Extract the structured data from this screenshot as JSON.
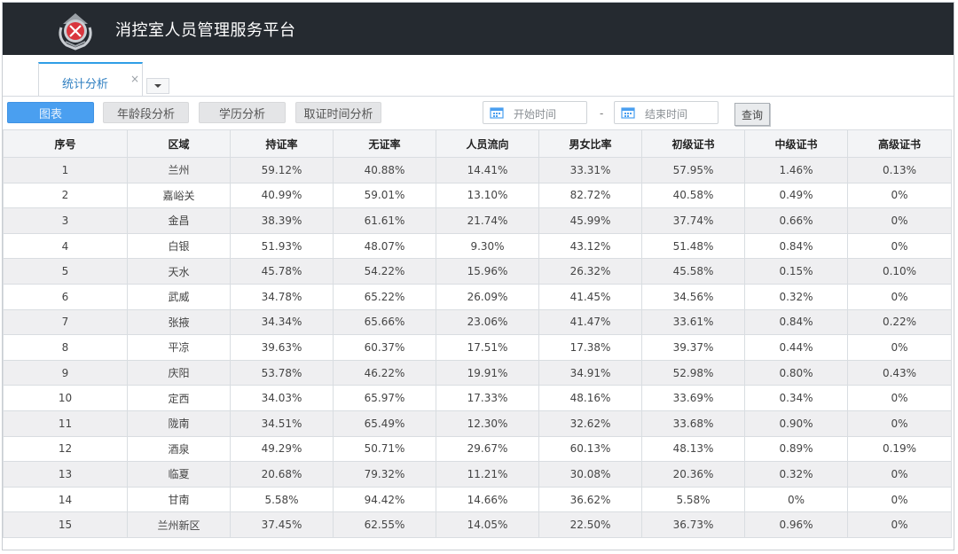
{
  "app": {
    "title": "消控室人员管理服务平台"
  },
  "tabs": [
    {
      "label": "统计分析",
      "close": "×"
    }
  ],
  "toolbar": {
    "buttons": [
      "图表",
      "年龄段分析",
      "学历分析",
      "取证时间分析"
    ],
    "start_placeholder": "开始时间",
    "separator": "-",
    "end_placeholder": "结束时间",
    "query_label": "查询"
  },
  "colors": {
    "header_bg": "#252a30",
    "primary": "#4a9ff0",
    "tab_accent": "#2f9ee6"
  },
  "table": {
    "headers": [
      "序号",
      "区域",
      "持证率",
      "无证率",
      "人员流向",
      "男女比率",
      "初级证书",
      "中级证书",
      "高级证书"
    ],
    "rows": [
      [
        "1",
        "兰州",
        "59.12%",
        "40.88%",
        "14.41%",
        "33.31%",
        "57.95%",
        "1.46%",
        "0.13%"
      ],
      [
        "2",
        "嘉峪关",
        "40.99%",
        "59.01%",
        "13.10%",
        "82.72%",
        "40.58%",
        "0.49%",
        "0%"
      ],
      [
        "3",
        "金昌",
        "38.39%",
        "61.61%",
        "21.74%",
        "45.99%",
        "37.74%",
        "0.66%",
        "0%"
      ],
      [
        "4",
        "白银",
        "51.93%",
        "48.07%",
        "9.30%",
        "43.12%",
        "51.48%",
        "0.84%",
        "0%"
      ],
      [
        "5",
        "天水",
        "45.78%",
        "54.22%",
        "15.96%",
        "26.32%",
        "45.58%",
        "0.15%",
        "0.10%"
      ],
      [
        "6",
        "武威",
        "34.78%",
        "65.22%",
        "26.09%",
        "41.45%",
        "34.56%",
        "0.32%",
        "0%"
      ],
      [
        "7",
        "张掖",
        "34.34%",
        "65.66%",
        "23.06%",
        "41.47%",
        "33.61%",
        "0.84%",
        "0.22%"
      ],
      [
        "8",
        "平凉",
        "39.63%",
        "60.37%",
        "17.51%",
        "17.38%",
        "39.37%",
        "0.44%",
        "0%"
      ],
      [
        "9",
        "庆阳",
        "53.78%",
        "46.22%",
        "19.91%",
        "34.91%",
        "52.98%",
        "0.80%",
        "0.43%"
      ],
      [
        "10",
        "定西",
        "34.03%",
        "65.97%",
        "17.33%",
        "48.16%",
        "33.69%",
        "0.34%",
        "0%"
      ],
      [
        "11",
        "陇南",
        "34.51%",
        "65.49%",
        "12.30%",
        "32.62%",
        "33.68%",
        "0.90%",
        "0%"
      ],
      [
        "12",
        "酒泉",
        "49.29%",
        "50.71%",
        "29.67%",
        "60.13%",
        "48.13%",
        "0.89%",
        "0.19%"
      ],
      [
        "13",
        "临夏",
        "20.68%",
        "79.32%",
        "11.21%",
        "30.08%",
        "20.36%",
        "0.32%",
        "0%"
      ],
      [
        "14",
        "甘南",
        "5.58%",
        "94.42%",
        "14.66%",
        "36.62%",
        "5.58%",
        "0%",
        "0%"
      ],
      [
        "15",
        "兰州新区",
        "37.45%",
        "62.55%",
        "14.05%",
        "22.50%",
        "36.73%",
        "0.96%",
        "0%"
      ]
    ]
  }
}
